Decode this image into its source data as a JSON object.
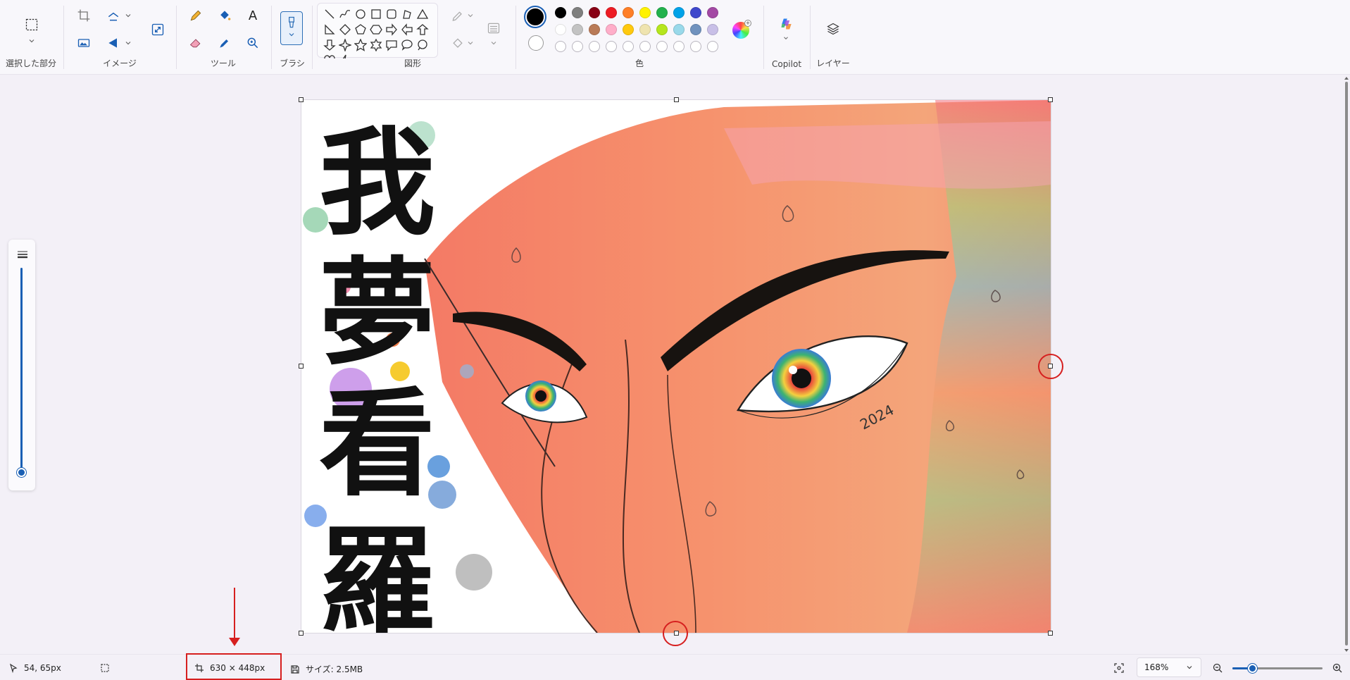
{
  "ribbon": {
    "groups": {
      "selection": "選択した部分",
      "image": "イメージ",
      "tools": "ツール",
      "brush": "ブラシ",
      "shapes": "図形",
      "colors": "色",
      "copilot": "Copilot",
      "layers": "レイヤー"
    },
    "tools_text_icon": "A"
  },
  "palette": {
    "primary": "#000000",
    "secondary": "#ffffff",
    "row1": [
      "#000000",
      "#7f7f7f",
      "#880015",
      "#ed1c24",
      "#ff7f27",
      "#fff200",
      "#22b14c",
      "#00a2e8",
      "#3f48cc",
      "#a349a4"
    ],
    "row2": [
      "#ffffff",
      "#c3c3c3",
      "#b97a57",
      "#ffaec9",
      "#ffc90e",
      "#efe4b0",
      "#b5e61d",
      "#99d9ea",
      "#7092be",
      "#c8bfe7"
    ],
    "row3_empty_count": 10
  },
  "status": {
    "cursor_pos": "54, 65px",
    "canvas_size": "630 × 448px",
    "file_size": "サイズ: 2.5MB",
    "zoom": "168%"
  },
  "canvas_art": {
    "calligraphy": [
      "我",
      "夢",
      "看",
      "羅"
    ],
    "signature_year": "2024"
  }
}
